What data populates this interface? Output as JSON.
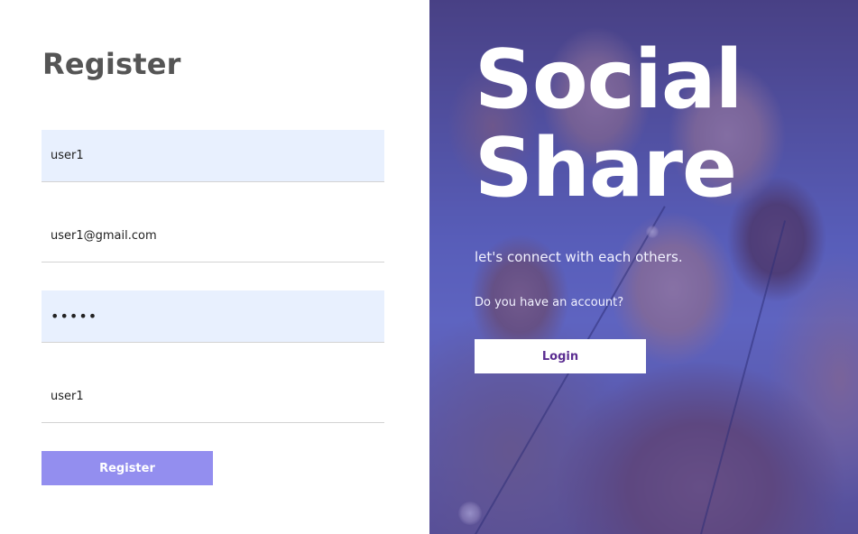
{
  "register": {
    "title": "Register",
    "fields": [
      {
        "name": "username",
        "value": "user1"
      },
      {
        "name": "email",
        "value": "user1@gmail.com"
      },
      {
        "name": "password",
        "value": "•••••"
      },
      {
        "name": "name",
        "value": "user1"
      }
    ],
    "submit_label": "Register"
  },
  "hero": {
    "title_line1": "Social",
    "title_line2": "Share",
    "tagline": "let's connect with each others.",
    "question": "Do you have an account?",
    "login_label": "Login"
  },
  "colors": {
    "register_button": "#938eef",
    "autofill_background": "#e8f0fe",
    "overlay": "#4646b9",
    "login_text": "#5b2d91",
    "title": "#555555"
  },
  "icons": {
    "background": "group-photo"
  }
}
